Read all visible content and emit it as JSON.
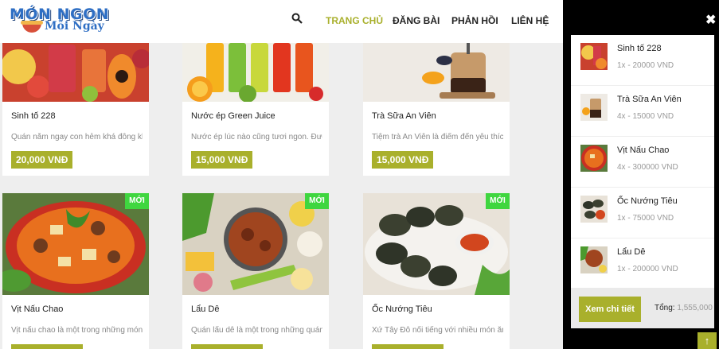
{
  "brand": {
    "logo_top": "MÓN NGON",
    "logo_bottom": "Mỗi Ngày"
  },
  "nav": [
    {
      "label": "TRANG CHỦ",
      "active": true
    },
    {
      "label": "ĐĂNG BÀI",
      "active": false
    },
    {
      "label": "PHẢN HỒI",
      "active": false
    },
    {
      "label": "LIÊN HỆ",
      "active": false
    }
  ],
  "products": [
    {
      "title": "Sinh tố 228",
      "desc": "Quán nằm ngay con hẻm khá đông khách",
      "price": "20,000 VNĐ",
      "badge": ""
    },
    {
      "title": "Nước ép Green Juice",
      "desc": "Nước ép lúc nào cũng tươi ngon. Được làm",
      "price": "15,000 VNĐ",
      "badge": ""
    },
    {
      "title": "Trà Sữa An Viên",
      "desc": "Tiệm trà An Viên là điểm đến yêu thích",
      "price": "15,000 VNĐ",
      "badge": ""
    },
    {
      "title": "Vịt Nấu Chao",
      "desc": "Vịt nấu chao là một trong những món ăn",
      "price": "",
      "badge": "MỚI"
    },
    {
      "title": "Lẩu Dê",
      "desc": "Quán lẩu dê là một trong những quán ăn",
      "price": "",
      "badge": "MỚI"
    },
    {
      "title": "Ốc Nướng Tiêu",
      "desc": "Xứ Tây Đô nổi tiếng với nhiều món ăn ngon",
      "price": "",
      "badge": "MỚI"
    }
  ],
  "cart": {
    "items": [
      {
        "name": "Sinh tố 228",
        "qty": "1x - 20000 VND"
      },
      {
        "name": "Trà Sữa An Viên",
        "qty": "4x - 15000 VND"
      },
      {
        "name": "Vịt Nấu Chao",
        "qty": "4x - 300000 VND"
      },
      {
        "name": "Ốc Nướng Tiêu",
        "qty": "1x - 75000 VND"
      },
      {
        "name": "Lẩu Dê",
        "qty": "1x - 200000 VND"
      }
    ],
    "detail_button": "Xem chi tiết",
    "total_label": "Tổng:",
    "total_value": "1,555,000"
  },
  "colors": {
    "accent": "#a9b02c",
    "new_badge": "#3fd63f",
    "drawer_bg": "#000000"
  },
  "icons": {
    "search": "search-icon",
    "close": "close-icon",
    "scroll_top": "arrow-up-icon"
  }
}
